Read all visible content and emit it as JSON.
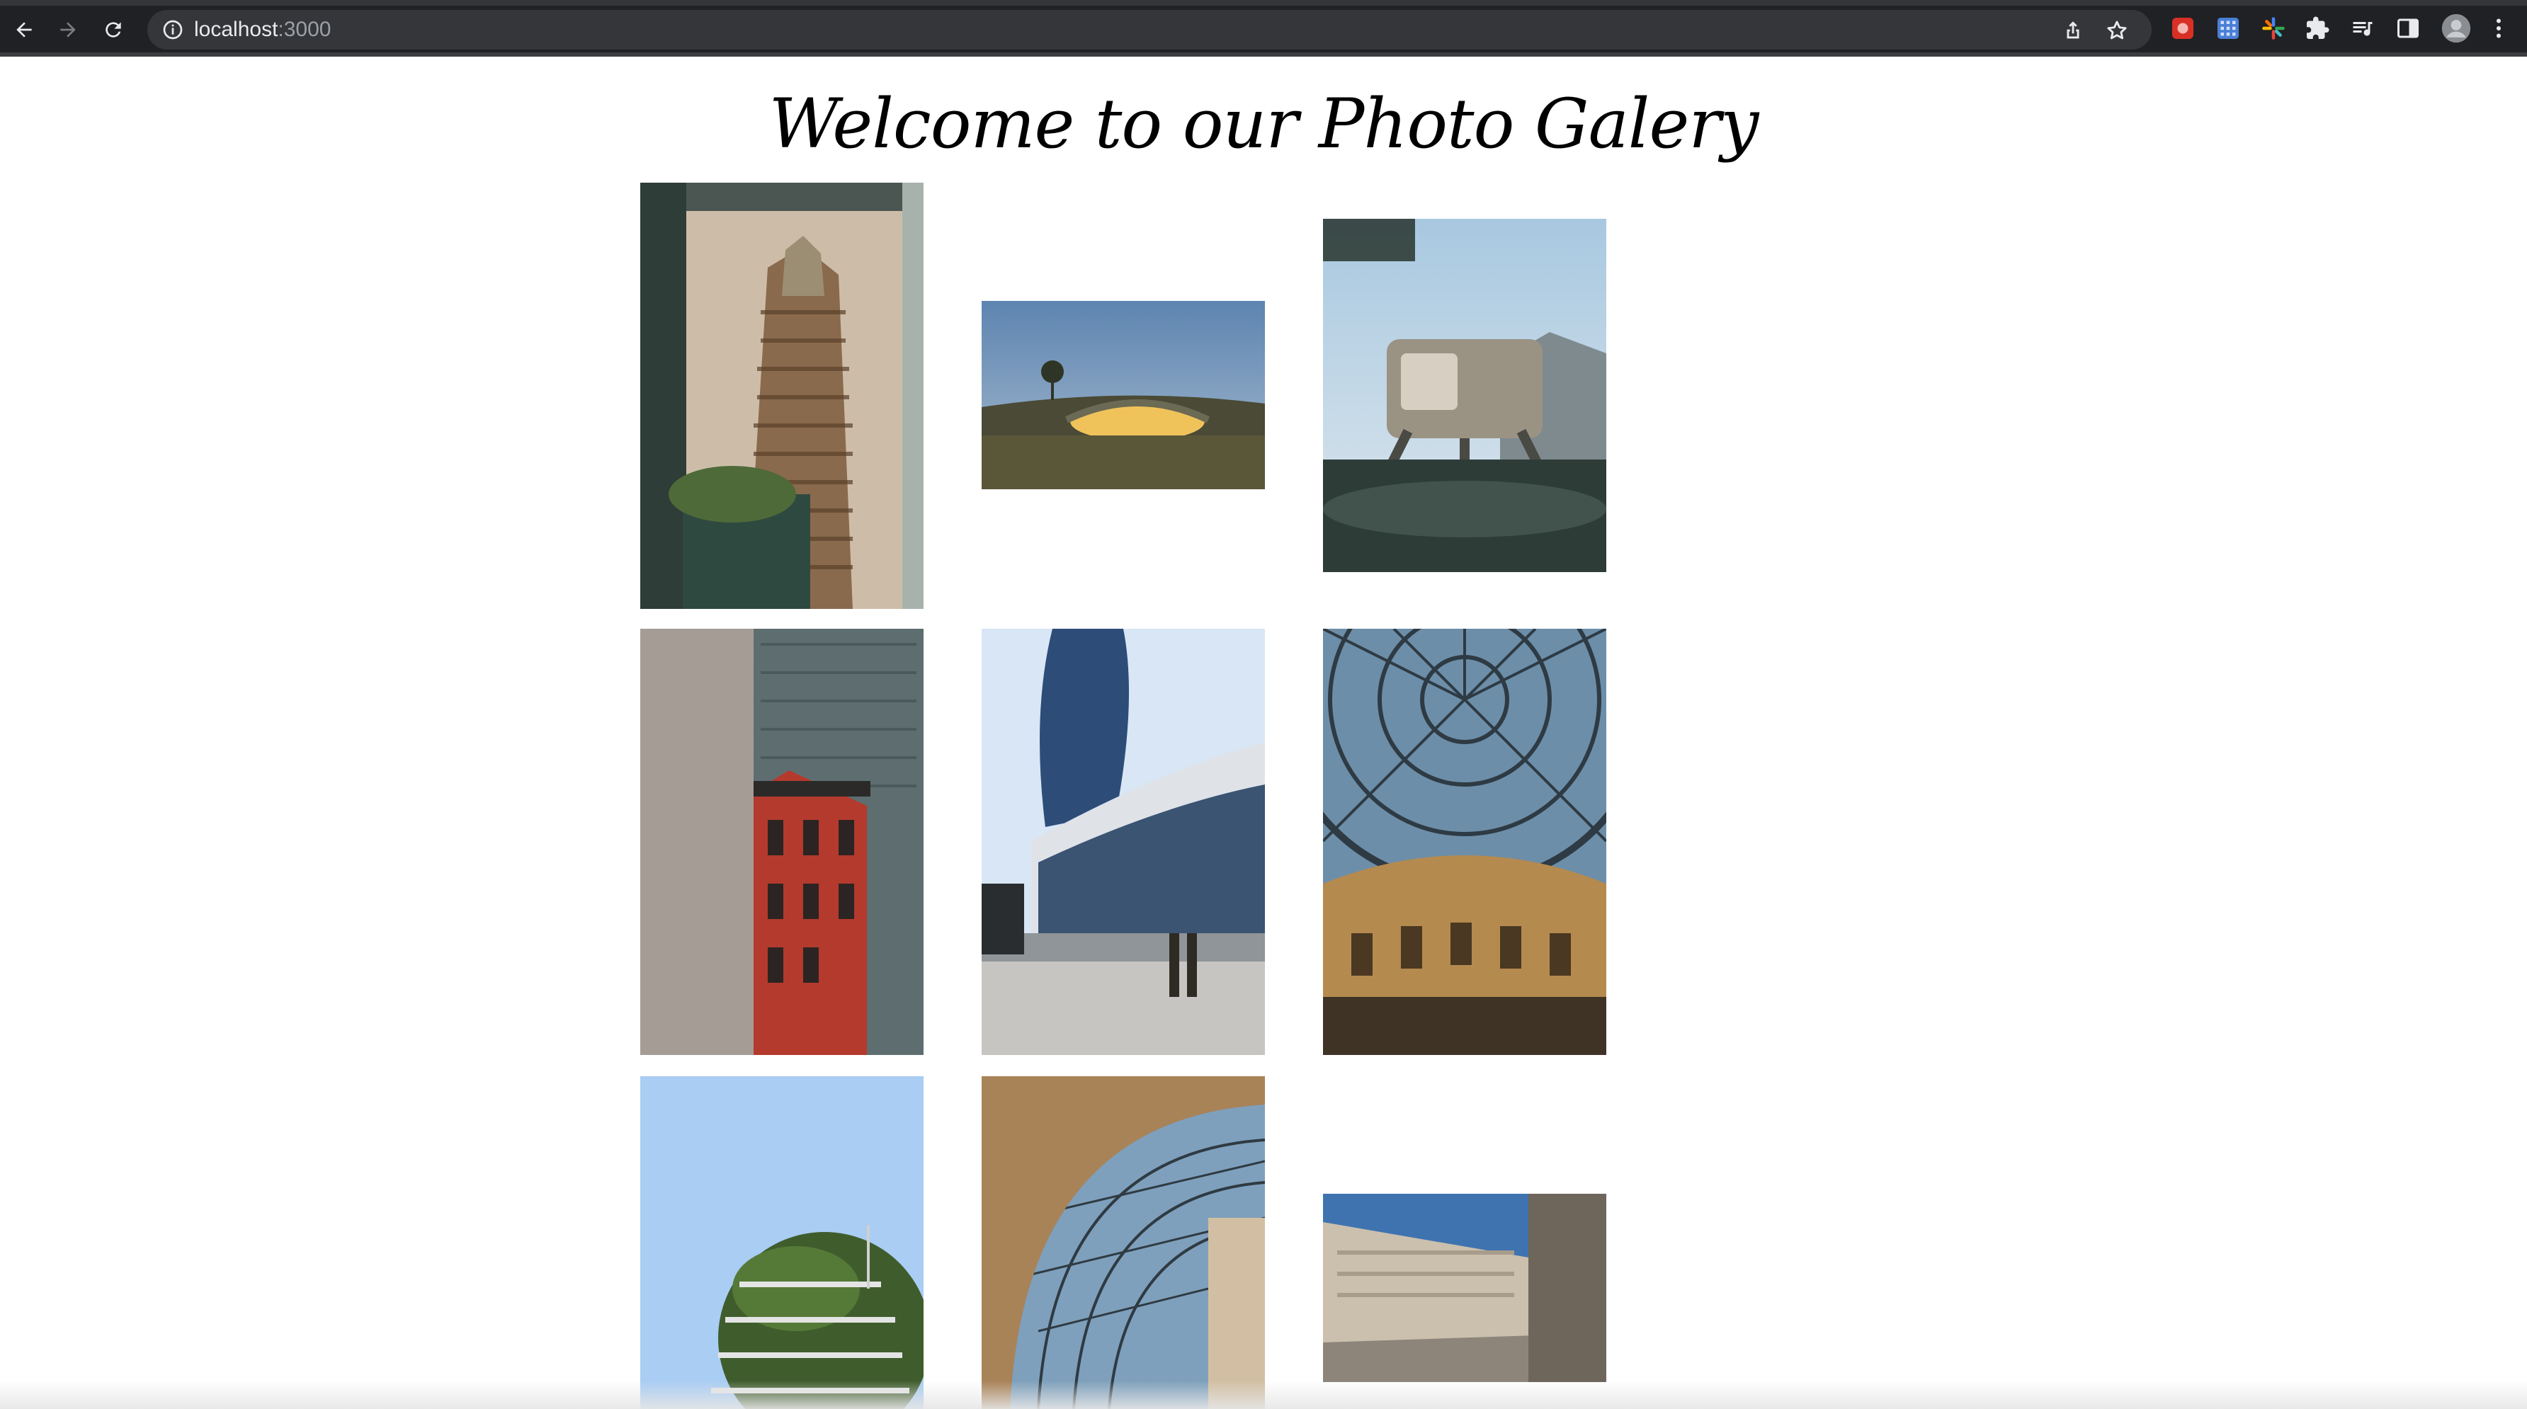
{
  "browser": {
    "url_host": "localhost",
    "url_port": ":3000",
    "back_icon": "arrow-left-icon",
    "forward_icon": "arrow-right-icon",
    "reload_icon": "reload-icon",
    "info_icon": "info-icon",
    "share_icon": "share-icon",
    "bookmark_icon": "star-icon",
    "extensions": [
      "extension-red-icon",
      "extension-grid-icon",
      "extension-pinwheel-icon",
      "puzzle-icon",
      "media-control-icon",
      "side-panel-icon",
      "profile-avatar-icon",
      "menu-kebab-icon"
    ]
  },
  "page": {
    "title": "Welcome to our Photo Galery"
  },
  "gallery": {
    "photos": [
      {
        "subject": "art deco skyscraper framed by dark columns",
        "colors": [
          "#c9b8a2",
          "#7a5a3e",
          "#2f3b36"
        ]
      },
      {
        "subject": "glowing earth-sheltered building at dusk",
        "colors": [
          "#6e8fb3",
          "#e0b24a",
          "#4c4a35"
        ]
      },
      {
        "subject": "futuristic walking house over water",
        "colors": [
          "#b8cfe0",
          "#8a8272",
          "#2b3a36"
        ]
      },
      {
        "subject": "red brick building with fire escape between towers",
        "colors": [
          "#8d8884",
          "#b3362b",
          "#5d6b6b"
        ]
      },
      {
        "subject": "curved glass tower and plaza with two people",
        "colors": [
          "#cfe0f4",
          "#2f4f7a",
          "#bdbab5"
        ]
      },
      {
        "subject": "glass dome of a shopping gallery",
        "colors": [
          "#6d8ea8",
          "#c99b5a",
          "#3f3326"
        ]
      },
      {
        "subject": "vertical forest tower against blue sky",
        "colors": [
          "#a9cdf3",
          "#3f5d2c",
          "#d8d8d8"
        ]
      },
      {
        "subject": "arched glass vault of a gallery",
        "colors": [
          "#8a6b4c",
          "#7ea0bc",
          "#d2bfa3"
        ]
      },
      {
        "subject": "modernist stone building with stairs",
        "colors": [
          "#3f73b0",
          "#cbbfae",
          "#6e655b"
        ]
      }
    ]
  }
}
